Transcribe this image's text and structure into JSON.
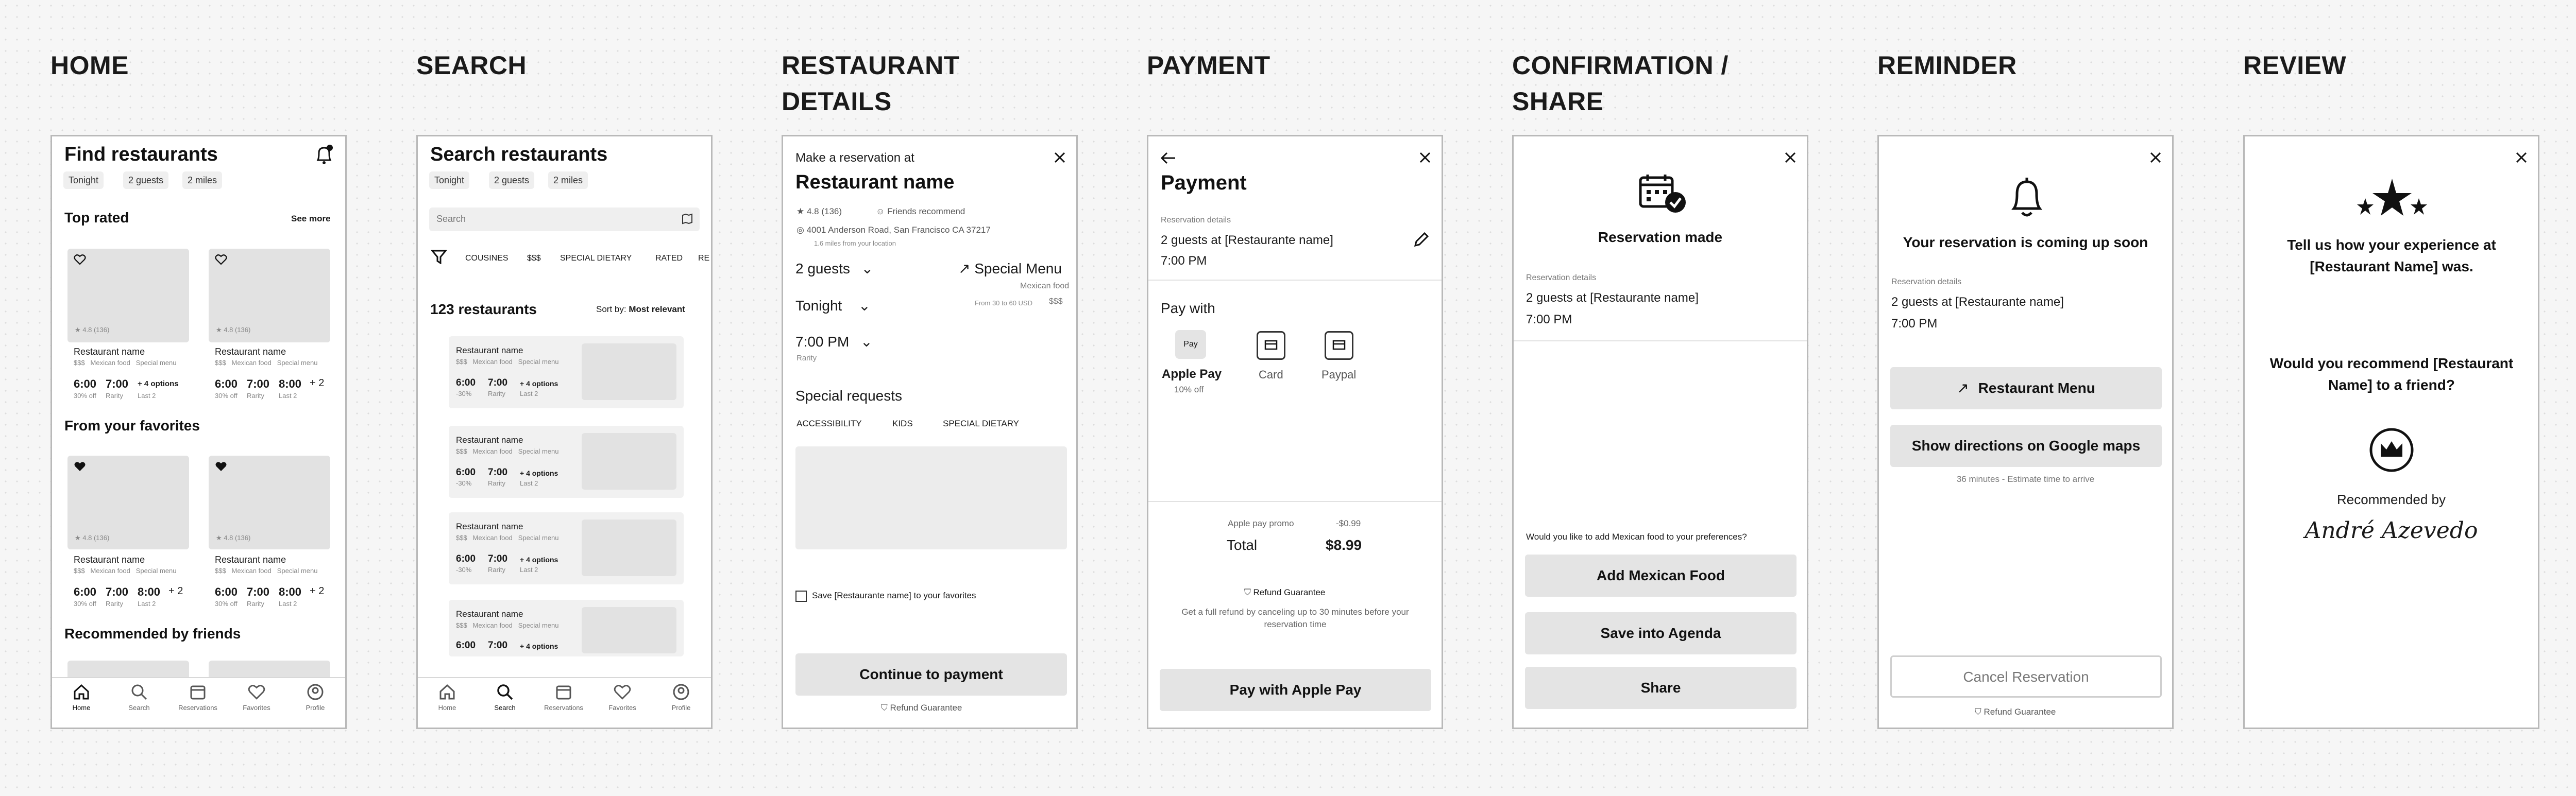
{
  "titles": {
    "home": "HOME",
    "search": "SEARCH",
    "details": "RESTAURANT DETAILS",
    "payment": "PAYMENT",
    "confirmation": "CONFIRMATION / SHARE",
    "reminder": "REMINDER",
    "review": "REVIEW"
  },
  "chips": {
    "tonight": "Tonight",
    "guests": "2 guests",
    "miles": "2 miles"
  },
  "nav": [
    "Home",
    "Search",
    "Reservations",
    "Favorites",
    "Profile"
  ],
  "card": {
    "rating": "4.8 (136)",
    "name": "Restaurant name",
    "price": "$$$",
    "cuisine": "Mexican food",
    "menu": "Special menu",
    "t1": "6:00",
    "t2": "7:00",
    "t3": "8:00",
    "more_opts": "+ 4 options",
    "more2": "+ 2",
    "s1": "30% off",
    "s2": "Rarity",
    "s3": "Last 2"
  },
  "home": {
    "title": "Find restaurants",
    "top_rated": "Top rated",
    "see_more": "See more",
    "favorites": "From your favorites",
    "friends": "Recommended by friends"
  },
  "search": {
    "title": "Search restaurants",
    "placeholder": "Search",
    "filters": [
      "COUSINES",
      "$$$",
      "SPECIAL DIETARY",
      "RATED",
      "RE"
    ],
    "count": "123 restaurants",
    "sort_label": "Sort by:",
    "sort_value": "Most relevant",
    "s1": "-30%"
  },
  "details": {
    "intro": "Make a reservation at",
    "name": "Restaurant name",
    "rating": "4.8 (136)",
    "friends": "Friends recommend",
    "address": "4001 Anderson Road, San Francisco CA 37217",
    "distance": "1.6 miles from your location",
    "guests": "2 guests",
    "special_menu": "Special Menu",
    "cuisine": "Mexican food",
    "price_range": "From 30 to 60 USD",
    "price": "$$$",
    "day": "Tonight",
    "time": "7:00 PM",
    "rarity": "Rarity",
    "requests": "Special requests",
    "tags": [
      "ACCESSIBILITY",
      "KIDS",
      "SPECIAL DIETARY"
    ],
    "save_fav": "Save [Restaurante name] to your favorites",
    "continue": "Continue to payment",
    "refund": "Refund Guarantee"
  },
  "payment": {
    "title": "Payment",
    "details_label": "Reservation details",
    "details_line": "2 guests at [Restaurante name]",
    "time": "7:00 PM",
    "pay_with": "Pay with",
    "apple_glyph": "Pay",
    "apple_pay": "Apple Pay",
    "apple_discount": "10% off",
    "card": "Card",
    "paypal": "Paypal",
    "promo_label": "Apple pay promo",
    "promo_value": "-$0.99",
    "total_label": "Total",
    "total_value": "$8.99",
    "refund": "Refund Guarantee",
    "refund_text": "Get a full refund by canceling up to 30 minutes before your reservation time",
    "pay_button": "Pay with Apple Pay"
  },
  "confirmation": {
    "title": "Reservation  made",
    "details_label": "Reservation details",
    "details_line": "2 guests at [Restaurante name]",
    "time": "7:00 PM",
    "question": "Would you like to add Mexican food to your preferences?",
    "add": "Add Mexican Food",
    "agenda": "Save into Agenda",
    "share": "Share"
  },
  "reminder": {
    "title": "Your reservation is coming up soon",
    "details_label": "Reservation details",
    "details_line": "2 guests at [Restaurante name]",
    "time": "7:00 PM",
    "menu": "Restaurant Menu",
    "directions": "Show directions on Google maps",
    "estimate": "36 minutes - Estimate time to arrive",
    "cancel": "Cancel Reservation",
    "refund": "Refund Guarantee"
  },
  "review": {
    "question1": "Tell us how your experience at [Restaurant Name] was.",
    "question2": "Would you recommend [Restaurant Name] to a friend?",
    "recommended": "Recommended by",
    "signature": "André Azevedo"
  }
}
